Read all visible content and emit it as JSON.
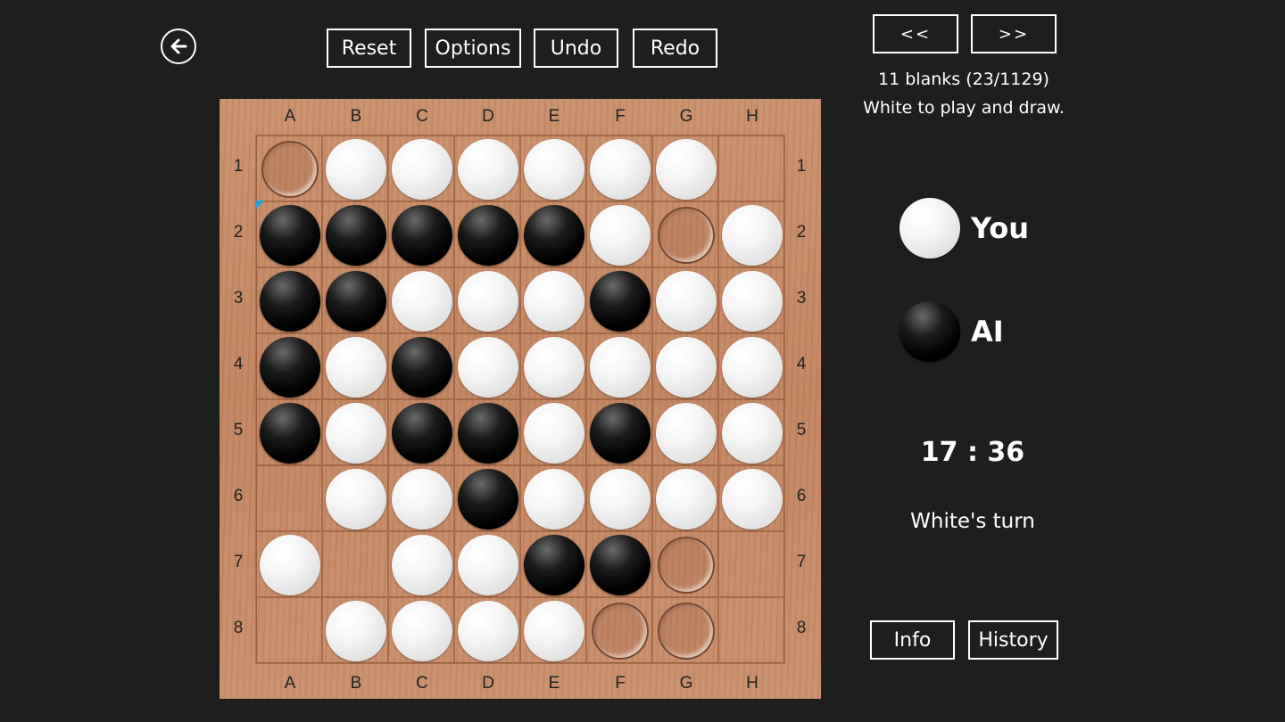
{
  "toolbar": {
    "reset_label": "Reset",
    "options_label": "Options",
    "undo_label": "Undo",
    "redo_label": "Redo"
  },
  "nav": {
    "prev_label": "<<",
    "next_label": ">>"
  },
  "puzzle": {
    "info_line": "11 blanks (23/1129)",
    "task_line": "White to play and draw."
  },
  "players": {
    "human": {
      "name": "You",
      "color": "white"
    },
    "ai": {
      "name": "AI",
      "color": "black"
    }
  },
  "score_text": "17 : 36",
  "turn_text": "White's turn",
  "footer": {
    "info_label": "Info",
    "history_label": "History"
  },
  "board": {
    "columns": [
      "A",
      "B",
      "C",
      "D",
      "E",
      "F",
      "G",
      "H"
    ],
    "rows": [
      "1",
      "2",
      "3",
      "4",
      "5",
      "6",
      "7",
      "8"
    ],
    "cells": [
      [
        "hint",
        "W",
        "W",
        "W",
        "W",
        "W",
        "W",
        "."
      ],
      [
        "B",
        "B",
        "B",
        "B",
        "B",
        "W",
        "hint",
        "W"
      ],
      [
        "B",
        "B",
        "W",
        "W",
        "W",
        "B",
        "W",
        "W"
      ],
      [
        "B",
        "W",
        "B",
        "W",
        "W",
        "W",
        "W",
        "W"
      ],
      [
        "B",
        "W",
        "B",
        "B",
        "W",
        "B",
        "W",
        "W"
      ],
      [
        ".",
        "W",
        "W",
        "B",
        "W",
        "W",
        "W",
        "W"
      ],
      [
        "W",
        ".",
        "W",
        "W",
        "B",
        "B",
        "hint",
        "."
      ],
      [
        ".",
        "W",
        "W",
        "W",
        "W",
        "hint",
        "hint",
        "."
      ]
    ],
    "last_move": "A2",
    "last_move_color": "#1aa3e0"
  },
  "colors": {
    "background": "#1e1e1e",
    "board_wood": "#c58a66",
    "text": "#ffffff"
  },
  "icons": {
    "back": "back-arrow-icon"
  }
}
